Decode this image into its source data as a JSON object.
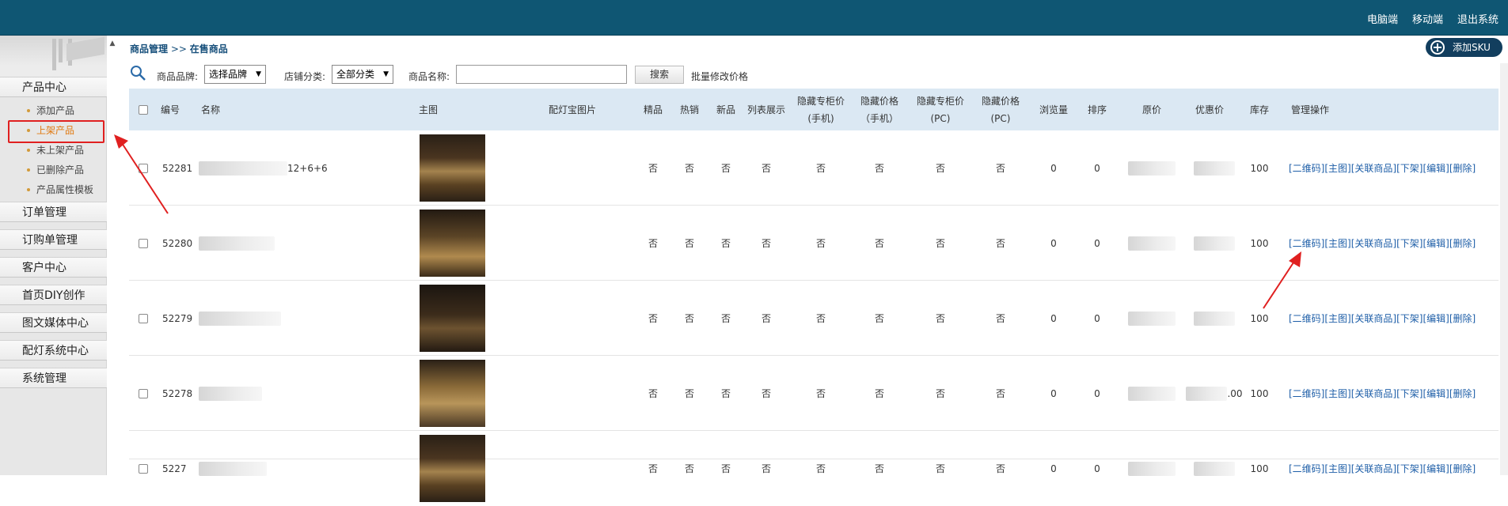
{
  "topnav": [
    "电脑端",
    "移动端",
    "退出系统"
  ],
  "sidebar": {
    "scroll_up": "▲",
    "categories": [
      {
        "label": "产品中心"
      },
      {
        "label": "订单管理"
      },
      {
        "label": "订购单管理"
      },
      {
        "label": "客户中心"
      },
      {
        "label": "首页DIY创作"
      },
      {
        "label": "图文媒体中心"
      },
      {
        "label": "配灯系统中心"
      },
      {
        "label": "系统管理"
      }
    ],
    "sub_items": [
      "添加产品",
      "上架产品",
      "未上架产品",
      "已删除产品",
      "产品属性模板"
    ]
  },
  "breadcrumb": {
    "part1": "商品管理",
    "sep": " >> ",
    "part2": "在售商品"
  },
  "add_sku": {
    "icon": "+",
    "label": "添加SKU"
  },
  "filters": {
    "brand_label": "商品品牌:",
    "brand_value": "选择品牌",
    "category_label": "店铺分类:",
    "category_value": "全部分类",
    "name_label": "商品名称:",
    "search_button": "搜索",
    "bulk_link": "批量修改价格"
  },
  "table": {
    "headers": {
      "id": "编号",
      "name": "名称",
      "main_img": "主图",
      "lamp_img": "配灯宝图片",
      "premium": "精品",
      "hot": "热销",
      "new": "新品",
      "list_show": "列表展示",
      "hide_price_mobile": "隐藏专柜价(手机)",
      "hide_price_mobile2": "隐藏价格（手机）",
      "hide_price_pc": "隐藏专柜价(PC)",
      "hide_price_pc2": "隐藏价格(PC)",
      "views": "浏览量",
      "sort": "排序",
      "orig_price": "原价",
      "sale_price": "优惠价",
      "stock": "库存",
      "ops": "管理操作"
    },
    "ops_labels": [
      "[二维码]",
      "[主图]",
      "[关联商品]",
      "[下架]",
      "[编辑]",
      "[删除]"
    ],
    "rows": [
      {
        "id": "52281",
        "name_tail": "12+6+6",
        "flags": [
          "否",
          "否",
          "否",
          "否",
          "否",
          "否",
          "否",
          "否"
        ],
        "views": "0",
        "sort": "0",
        "sale_tail": "",
        "stock": "100"
      },
      {
        "id": "52280",
        "name_tail": "",
        "flags": [
          "否",
          "否",
          "否",
          "否",
          "否",
          "否",
          "否",
          "否"
        ],
        "views": "0",
        "sort": "0",
        "sale_tail": "",
        "stock": "100"
      },
      {
        "id": "52279",
        "name_tail": "",
        "flags": [
          "否",
          "否",
          "否",
          "否",
          "否",
          "否",
          "否",
          "否"
        ],
        "views": "0",
        "sort": "0",
        "sale_tail": "",
        "stock": "100"
      },
      {
        "id": "52278",
        "name_tail": "",
        "flags": [
          "否",
          "否",
          "否",
          "否",
          "否",
          "否",
          "否",
          "否"
        ],
        "views": "0",
        "sort": "0",
        "sale_tail": ".00",
        "stock": "100"
      },
      {
        "id": "5227",
        "name_tail": "",
        "flags": [
          "否",
          "否",
          "否",
          "否",
          "否",
          "否",
          "否",
          "否"
        ],
        "views": "0",
        "sort": "0",
        "sale_tail": "",
        "stock": "100"
      }
    ]
  },
  "colors": {
    "topbar": "#0f5673",
    "header_row": "#dbe8f3",
    "link": "#1f5fa8",
    "highlight": "#e02020"
  }
}
